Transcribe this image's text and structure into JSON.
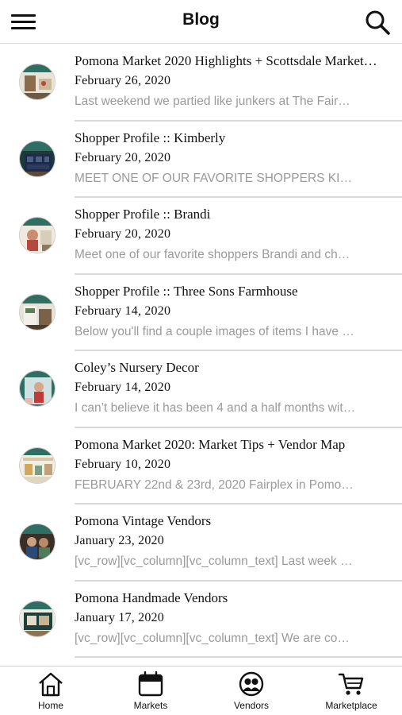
{
  "header": {
    "title": "Blog",
    "menu_icon": "hamburger-menu-icon",
    "search_icon": "search-icon"
  },
  "posts": [
    {
      "title": "Pomona Market 2020 Highlights + Scottsdale Market…",
      "date": "February 26, 2020",
      "excerpt": "Last weekend we partied like junkers at The Fair…"
    },
    {
      "title": "Shopper Profile :: Kimberly",
      "date": "February 20, 2020",
      "excerpt": "MEET ONE OF OUR FAVORITE SHOPPERS KI…"
    },
    {
      "title": "Shopper Profile :: Brandi",
      "date": "February 20, 2020",
      "excerpt": "Meet one of our favorite shoppers Brandi and ch…"
    },
    {
      "title": "Shopper Profile :: Three Sons Farmhouse",
      "date": "February 14, 2020",
      "excerpt": "Below you'll find a couple images of items I have …"
    },
    {
      "title": "Coley’s Nursery Decor",
      "date": "February 14, 2020",
      "excerpt": "I can’t believe it has been 4 and a half months wit…"
    },
    {
      "title": "Pomona Market 2020: Market Tips + Vendor Map",
      "date": "February 10, 2020",
      "excerpt": "FEBRUARY 22nd & 23rd, 2020 Fairplex in Pomo…"
    },
    {
      "title": "Pomona Vintage Vendors",
      "date": "January 23, 2020",
      "excerpt": "[vc_row][vc_column][vc_column_text] Last week …"
    },
    {
      "title": "Pomona Handmade Vendors",
      "date": "January 17, 2020",
      "excerpt": "[vc_row][vc_column][vc_column_text] We are co…"
    }
  ],
  "tabs": [
    {
      "label": "Home",
      "icon": "home-icon"
    },
    {
      "label": "Markets",
      "icon": "calendar-icon"
    },
    {
      "label": "Vendors",
      "icon": "vendors-icon"
    },
    {
      "label": "Marketplace",
      "icon": "cart-icon"
    }
  ],
  "colors": {
    "text": "#111111",
    "excerpt": "#9a9a9a",
    "divider": "#d9d9d9",
    "thumb_teal": "#2f6f63"
  }
}
